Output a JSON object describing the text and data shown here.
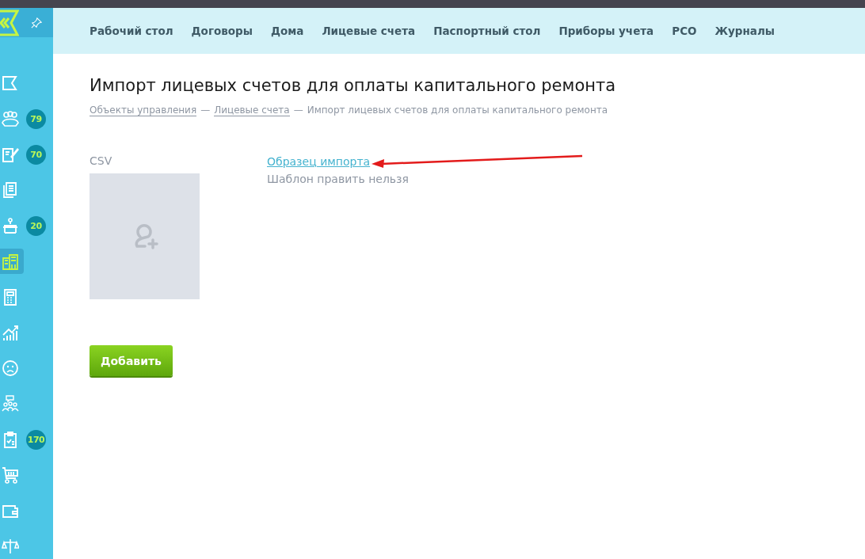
{
  "nav": [
    {
      "label": "Рабочий стол"
    },
    {
      "label": "Договоры"
    },
    {
      "label": "Дома"
    },
    {
      "label": "Лицевые счета"
    },
    {
      "label": "Паспортный стол"
    },
    {
      "label": "Приборы учета"
    },
    {
      "label": "РСО"
    },
    {
      "label": "Журналы"
    }
  ],
  "sidebar": {
    "items": [
      {
        "selected": false
      },
      {
        "selected": false,
        "badge": "79"
      },
      {
        "selected": false,
        "badge": "70"
      },
      {
        "selected": false
      },
      {
        "selected": false,
        "badge": "20"
      },
      {
        "selected": true
      },
      {
        "selected": false
      },
      {
        "selected": false
      },
      {
        "selected": false
      },
      {
        "selected": false
      },
      {
        "selected": false,
        "badge": "170"
      },
      {
        "selected": false
      },
      {
        "selected": false
      },
      {
        "selected": false
      }
    ]
  },
  "page": {
    "title": "Импорт лицевых счетов для оплаты капитального ремонта",
    "breadcrumbs": [
      {
        "label": "Объекты управления",
        "kind": "link"
      },
      {
        "label": "—",
        "kind": "separator"
      },
      {
        "label": "Лицевые счета",
        "kind": "link"
      },
      {
        "label": "—",
        "kind": "separator"
      },
      {
        "label": "Импорт лицевых счетов для оплаты капитального ремонта",
        "kind": "current"
      }
    ]
  },
  "upload": {
    "label": "CSV",
    "sample_link": "Образец импорта",
    "note": "Шаблон править нельзя"
  },
  "buttons": [
    {
      "label": "Добавить"
    }
  ]
}
